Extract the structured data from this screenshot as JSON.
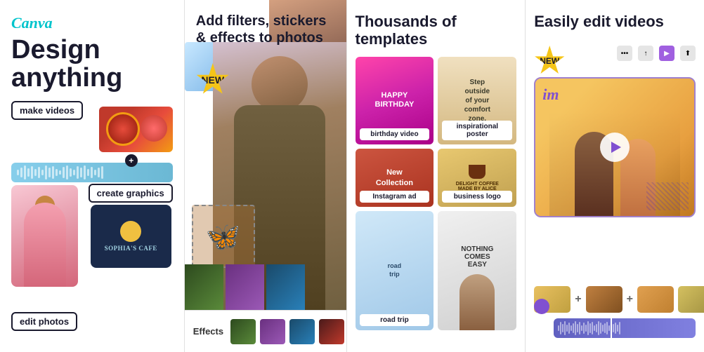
{
  "panel1": {
    "logo": "Canva",
    "title": "Design anything",
    "make_videos": "make videos",
    "create_graphics": "create graphics",
    "edit_photos": "edit photos",
    "cafe_name": "SOPHIA'S CAFE"
  },
  "panel2": {
    "title": "Add filters, stickers & effects to photos",
    "new_badge": "NEW",
    "effects_label": "Effects",
    "close_label": "×"
  },
  "panel3": {
    "title": "Thousands of templates",
    "templates": [
      {
        "id": "birthday",
        "label": "birthday video"
      },
      {
        "id": "poster",
        "label": "inspirational poster"
      },
      {
        "id": "instagram",
        "label": "Instagram ad"
      },
      {
        "id": "logo",
        "label": "business logo"
      },
      {
        "id": "road",
        "label": "road trip"
      },
      {
        "id": "person",
        "label": ""
      }
    ]
  },
  "panel4": {
    "title": "Easily edit videos",
    "new_badge": "NEW",
    "play_label": "▶"
  }
}
